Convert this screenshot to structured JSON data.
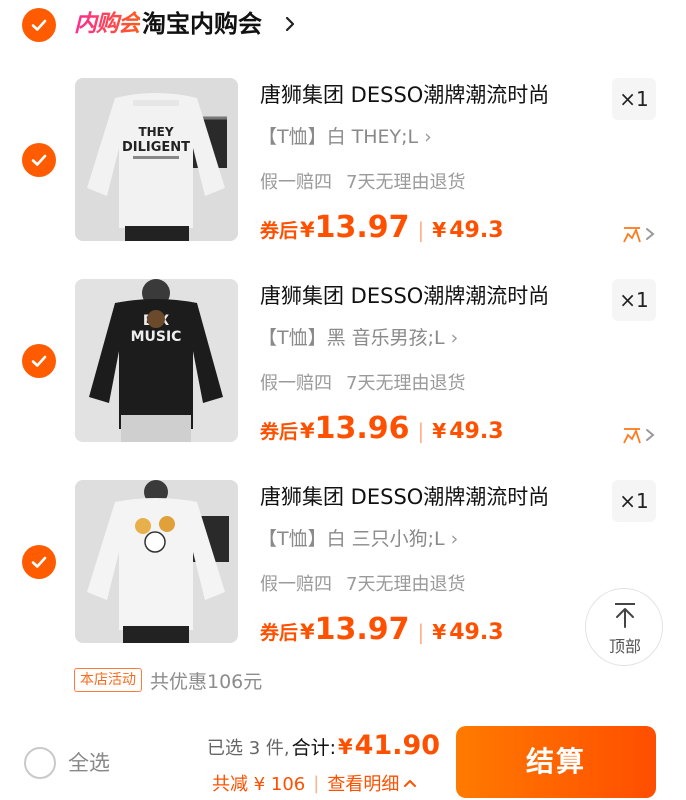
{
  "shop": {
    "badge": "内购会",
    "name": "淘宝内购会"
  },
  "items": [
    {
      "title": "唐狮集团 DESSO潮牌潮流时尚",
      "spec": "【T恤】白 THEY;L",
      "service_1": "假一赔四",
      "service_2": "7天无理由退货",
      "price_label": "券后",
      "currency": "¥",
      "price": "13.97",
      "original_price": "49.3",
      "quantity": "×1",
      "shirt_color": "#f2f2f2"
    },
    {
      "title": "唐狮集团 DESSO潮牌潮流时尚",
      "spec": "【T恤】黑 音乐男孩;L",
      "service_1": "假一赔四",
      "service_2": "7天无理由退货",
      "price_label": "券后",
      "currency": "¥",
      "price": "13.96",
      "original_price": "49.3",
      "quantity": "×1",
      "shirt_color": "#1c1c1c"
    },
    {
      "title": "唐狮集团 DESSO潮牌潮流时尚",
      "spec": "【T恤】白 三只小狗;L",
      "service_1": "假一赔四",
      "service_2": "7天无理由退货",
      "price_label": "券后",
      "currency": "¥",
      "price": "13.97",
      "original_price": "49.3",
      "quantity": "×1",
      "shirt_color": "#f4f4f4"
    }
  ],
  "back_to_top": {
    "label": "顶部"
  },
  "promo": {
    "tag": "本店活动",
    "text": "共优惠106元"
  },
  "footer": {
    "select_all_label": "全选",
    "selected_count": "已选 3 件,",
    "total_label": "合计:",
    "currency": "¥",
    "total": "41.90",
    "discount": "共减 ¥ 106",
    "detail_link": "查看明细",
    "checkout_label": "结算"
  },
  "colors": {
    "accent": "#ff5000",
    "checkout_gradient_start": "#ff7a00",
    "checkout_gradient_end": "#ff4e00"
  }
}
